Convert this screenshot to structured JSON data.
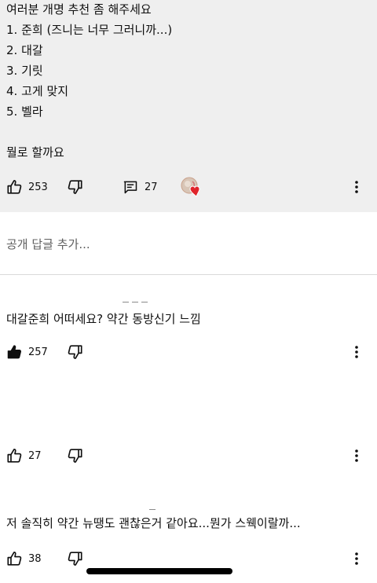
{
  "top_comment": {
    "lines": [
      "여러분 개명 추천 좀 해주세요",
      "1. 준희 (즈니는 너무 그러니까...)",
      "2. 대갈",
      "3. 기릿",
      "4. 고게 맞지",
      "5. 벨라",
      "",
      "뭘로 할까요"
    ],
    "likes": "253",
    "replies": "27"
  },
  "reply_input": {
    "placeholder": "공개 답글 추가..."
  },
  "replies": [
    {
      "text": "대갈준희 어떠세요? 약간 동방신기 느낌",
      "likes": "257",
      "liked": true
    },
    {
      "text": "",
      "likes": "27",
      "liked": false
    },
    {
      "text": "저 솔직히 약간 뉴땡도 괜찮은거 같아요...뭔가 스웩이랄까...",
      "likes": "38",
      "liked": false
    }
  ],
  "colors": {
    "top_background": "#efefef",
    "text": "#0f0f0f",
    "placeholder": "#606060",
    "heart": "#e0242b"
  }
}
